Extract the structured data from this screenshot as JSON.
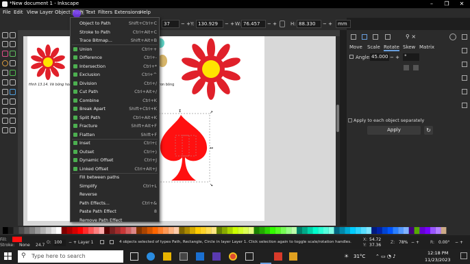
{
  "window": {
    "title": "*New document 1 - Inkscape"
  },
  "menubar": {
    "items": [
      "File",
      "Edit",
      "View",
      "Layer",
      "Object",
      "Path",
      "Text",
      "Filters",
      "Extensions",
      "Help"
    ],
    "active": "Path"
  },
  "controls": {
    "x_value": "37",
    "y_label": "Y:",
    "y_value": "130.929",
    "w_label": "W:",
    "w_value": "76.457",
    "h_label": "H:",
    "h_value": "88.330",
    "unit": "mm"
  },
  "path_menu": [
    {
      "label": "Object to Path",
      "shortcut": "Shift+Ctrl+C"
    },
    {
      "label": "Stroke to Path",
      "shortcut": "Ctrl+Alt+C"
    },
    {
      "label": "Trace Bitmap...",
      "shortcut": "Shift+Alt+B"
    },
    {
      "label": "Union",
      "shortcut": "Ctrl++"
    },
    {
      "label": "Difference",
      "shortcut": "Ctrl+-"
    },
    {
      "label": "Intersection",
      "shortcut": "Ctrl+*"
    },
    {
      "label": "Exclusion",
      "shortcut": "Ctrl+^"
    },
    {
      "label": "Division",
      "shortcut": "Ctrl+/"
    },
    {
      "label": "Cut Path",
      "shortcut": "Ctrl+Alt+/"
    },
    {
      "label": "Combine",
      "shortcut": "Ctrl+K"
    },
    {
      "label": "Break Apart",
      "shortcut": "Shift+Ctrl+K"
    },
    {
      "label": "Split Path",
      "shortcut": "Ctrl+Alt+K"
    },
    {
      "label": "Fracture",
      "shortcut": "Shift+Alt+F"
    },
    {
      "label": "Flatten",
      "shortcut": "Shift+F"
    },
    {
      "label": "Inset",
      "shortcut": "Ctrl+("
    },
    {
      "label": "Outset",
      "shortcut": "Ctrl+)"
    },
    {
      "label": "Dynamic Offset",
      "shortcut": "Ctrl+J"
    },
    {
      "label": "Linked Offset",
      "shortcut": "Ctrl+Alt+J"
    },
    {
      "label": "Fill between paths",
      "shortcut": ""
    },
    {
      "label": "Simplify",
      "shortcut": "Ctrl+L"
    },
    {
      "label": "Reverse",
      "shortcut": ""
    },
    {
      "label": "Path Effects...",
      "shortcut": "Ctrl+&"
    },
    {
      "label": "Paste Path Effect",
      "shortcut": "8"
    },
    {
      "label": "Remove Path Effect",
      "shortcut": ""
    }
  ],
  "canvas": {
    "caption": "Hinh 13.14. Vẽ bông hoa",
    "caption2": "ron bông"
  },
  "transform_panel": {
    "tabs": [
      "Move",
      "Scale",
      "Rotate",
      "Skew",
      "Matrix"
    ],
    "selected_tab": "Rotate",
    "angle_label": "Angle:",
    "angle_value": "45.000",
    "angle_unit": "°",
    "apply_each_label": "Apply to each object separately",
    "apply_button": "Apply"
  },
  "statusbar": {
    "fill_label": "Fill:",
    "stroke_label": "Stroke:",
    "stroke_value": "None",
    "stroke_width": "24.7",
    "opacity_label": "O:",
    "opacity_value": "100",
    "layer": "Layer 1",
    "message": "4 objects selected of types Path, Rectangle, Circle in layer Layer 1. Click selection again to toggle scale/rotation handles.",
    "x_label": "X:",
    "x_value": "54.72",
    "y_label": "Y:",
    "y_value": "37.36",
    "z_label": "Z:",
    "zoom": "78%",
    "r_label": "R:",
    "rotation": "0.00°"
  },
  "taskbar": {
    "search_placeholder": "Type here to search",
    "weather": "31°C",
    "time": "12:18 PM",
    "date": "11/23/2023"
  },
  "colors": {
    "accent": "#6aa0e0",
    "flower_red": "#e0202a",
    "flower_yellow": "#ffe400",
    "spade_red": "#ff1010"
  }
}
